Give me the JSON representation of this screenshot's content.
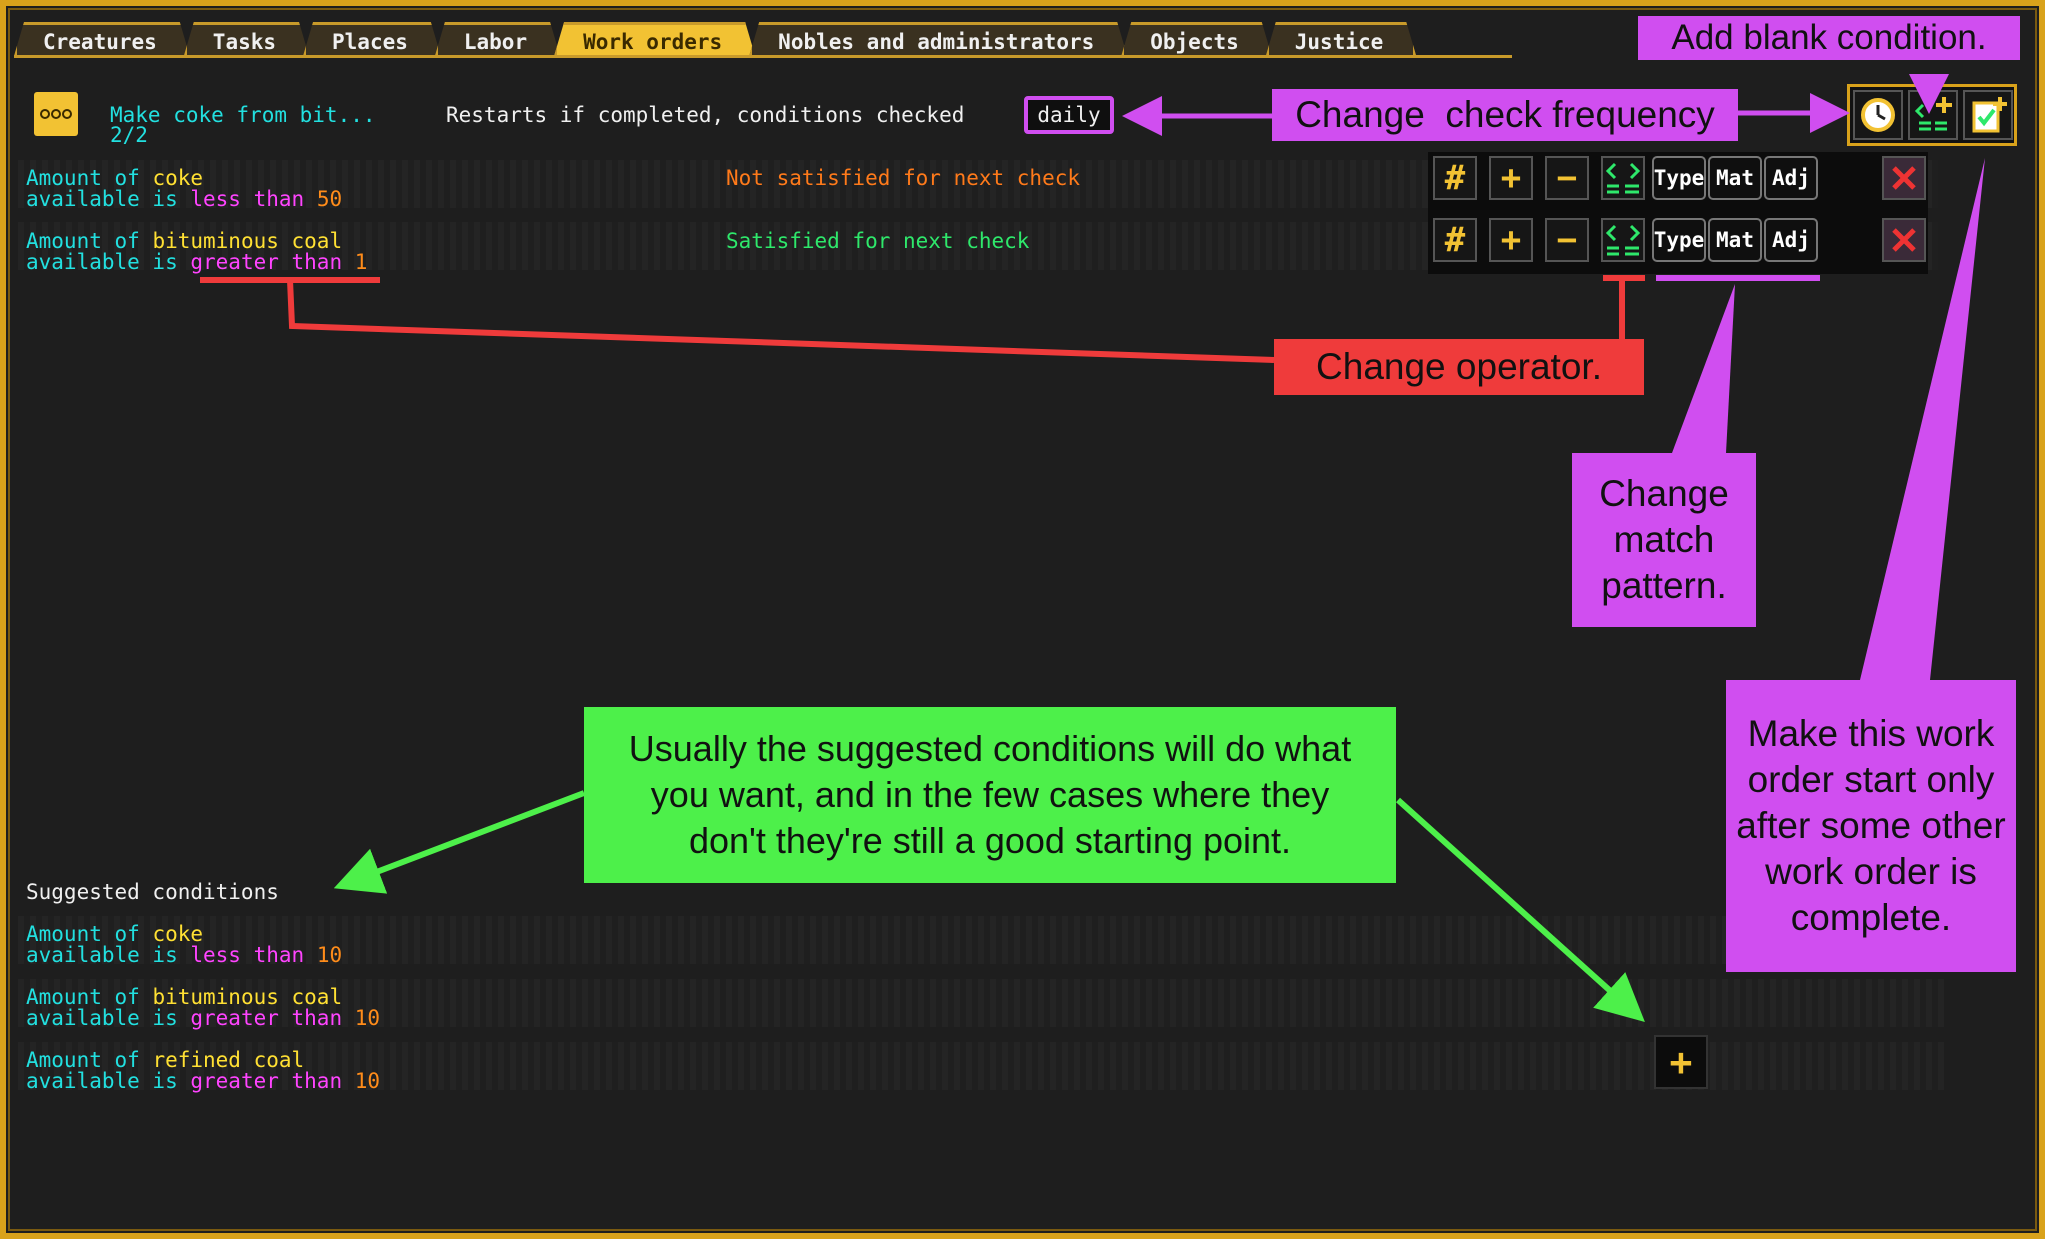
{
  "tabs": [
    {
      "label": "Creatures",
      "active": false
    },
    {
      "label": "Tasks",
      "active": false
    },
    {
      "label": "Places",
      "active": false
    },
    {
      "label": "Labor",
      "active": false
    },
    {
      "label": "Work orders",
      "active": true
    },
    {
      "label": "Nobles and administrators",
      "active": false
    },
    {
      "label": "Objects",
      "active": false
    },
    {
      "label": "Justice",
      "active": false
    }
  ],
  "order": {
    "title": "Make coke from bit...",
    "count": "2/2",
    "restart_text": "Restarts if completed, conditions checked",
    "frequency": "daily",
    "icon": "ellipsis-icon"
  },
  "header_buttons": {
    "clock": "clock-icon",
    "add_condition": "add-condition-icon",
    "order_condition": "clipboard-check-icon"
  },
  "conditions": [
    {
      "l1_prefix": "Amount of ",
      "item": "coke",
      "l2_prefix": "available is ",
      "operator": "less than",
      "value": "50",
      "status": "Not satisfied for next check",
      "satisfied": false
    },
    {
      "l1_prefix": "Amount of ",
      "item": "bituminous coal",
      "l2_prefix": "available is ",
      "operator": "greater than",
      "value": "1",
      "status": "Satisfied for next check",
      "satisfied": true
    }
  ],
  "row_buttons": {
    "type": "Type",
    "mat": "Mat",
    "adj": "Adj"
  },
  "suggested_title": "Suggested conditions",
  "suggested": [
    {
      "l1_prefix": "Amount of ",
      "item": "coke",
      "l2_prefix": "available is ",
      "operator": "less than",
      "value": "10"
    },
    {
      "l1_prefix": "Amount of ",
      "item": "bituminous coal",
      "l2_prefix": "available is ",
      "operator": "greater than",
      "value": "10"
    },
    {
      "l1_prefix": "Amount of ",
      "item": "refined coal",
      "l2_prefix": "available is ",
      "operator": "greater than",
      "value": "10"
    }
  ],
  "callouts": {
    "add_blank": "Add blank condition.",
    "check_freq": "Change  check frequency",
    "operator": "Change operator.",
    "match": "Change match pattern.",
    "work_order": "Make this work order start only after some other work order is complete.",
    "suggested": "Usually the suggested conditions will do what you want, and in the few cases where they don't they're still a good starting point."
  },
  "colors": {
    "gold": "#d9a21b",
    "purple": "#d04ef0",
    "red": "#ef3b3b",
    "green": "#4df04a",
    "cyan": "#22e0e0",
    "yellow": "#ffe033",
    "magenta": "#ff44ff"
  }
}
